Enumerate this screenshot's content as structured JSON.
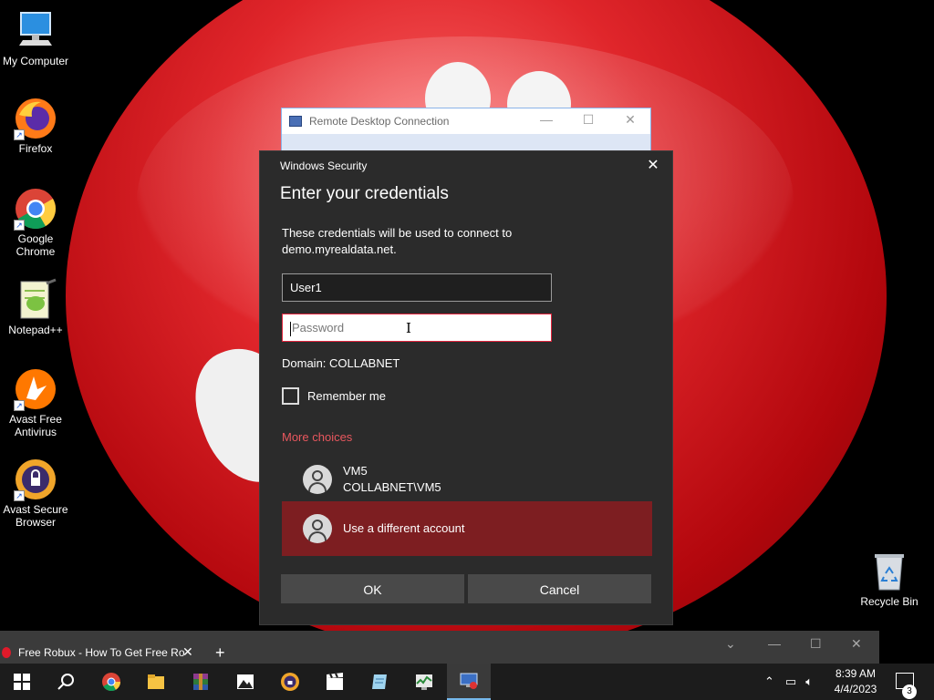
{
  "desktop": {
    "icons": [
      {
        "label": "My Computer",
        "icon": "monitor-icon"
      },
      {
        "label": "Firefox",
        "icon": "firefox-icon"
      },
      {
        "label": "Google Chrome",
        "icon": "chrome-icon"
      },
      {
        "label": "Notepad++",
        "icon": "notepadpp-icon"
      },
      {
        "label": "Avast Free Antivirus",
        "icon": "avast-icon"
      },
      {
        "label": "Avast Secure Browser",
        "icon": "avast-browser-icon"
      },
      {
        "label": "Recycle Bin",
        "icon": "recycle-bin-icon"
      }
    ]
  },
  "rdc_window": {
    "title": "Remote Desktop Connection"
  },
  "dialog": {
    "caption": "Windows Security",
    "heading": "Enter your credentials",
    "description": "These credentials will be used to connect to demo.myrealdata.net.",
    "username_value": "User1",
    "password_placeholder": "Password",
    "domain": "Domain: COLLABNET",
    "remember_label": "Remember me",
    "more_choices": "More choices",
    "accounts": [
      {
        "name": "VM5",
        "detail": "COLLABNET\\VM5"
      },
      {
        "name": "Use a different account"
      }
    ],
    "ok_label": "OK",
    "cancel_label": "Cancel",
    "colors": {
      "background": "#2b2b2b",
      "accent": "#e8575e",
      "selected": "#7d1e21"
    }
  },
  "browser": {
    "tab_title": "Free Robux - How To Get Free Ro"
  },
  "taskbar": {
    "apps": [
      "windows-start-icon",
      "search-icon",
      "chrome-icon",
      "file-explorer-icon",
      "winrar-icon",
      "photos-icon",
      "avast-browser-icon",
      "media-icon",
      "notepad-icon",
      "task-manager-icon",
      "remote-desktop-icon"
    ],
    "time": "8:39 AM",
    "date": "4/4/2023",
    "notification_count": "3"
  }
}
